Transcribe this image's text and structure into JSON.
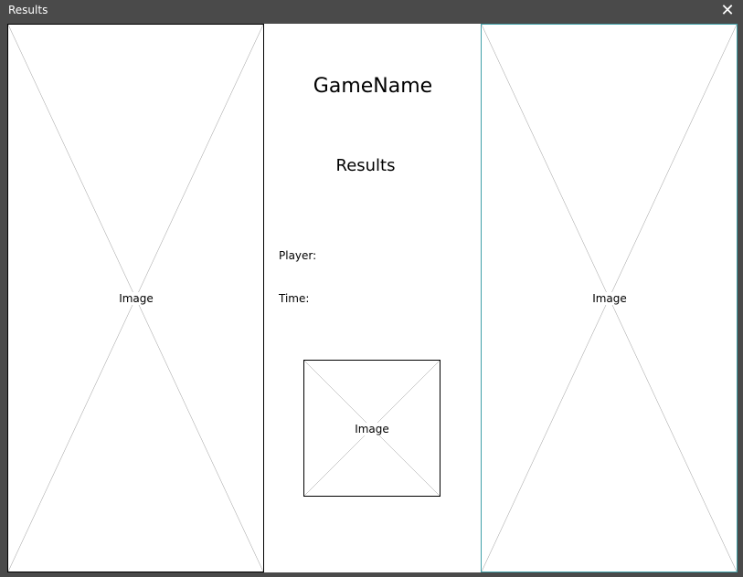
{
  "window": {
    "title": "Results",
    "close_glyph": "✕"
  },
  "left_image": {
    "label": "Image"
  },
  "right_image": {
    "label": "Image"
  },
  "center_image": {
    "label": "Image"
  },
  "main": {
    "game_name": "GameName",
    "results_heading": "Results",
    "player_label": "Player:",
    "time_label": "Time:"
  },
  "colors": {
    "titlebar": "#4a4a4a",
    "client_background": "#ffffff",
    "selected_border": "#40a0a8"
  }
}
